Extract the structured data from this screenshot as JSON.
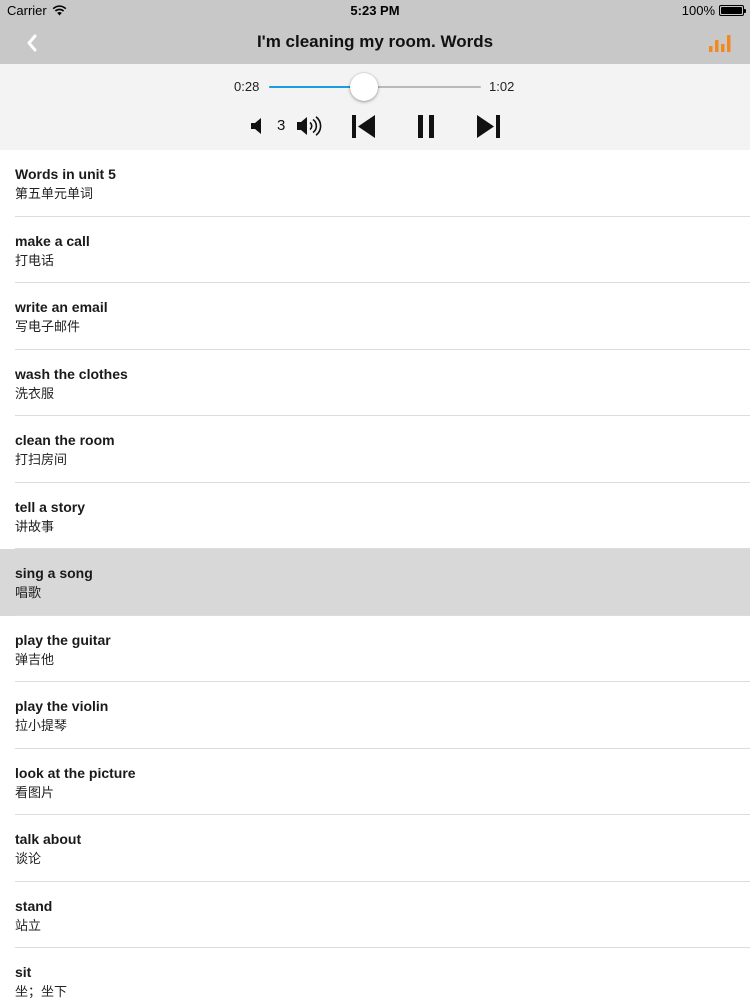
{
  "status_bar": {
    "carrier": "Carrier",
    "time": "5:23 PM",
    "battery": "100%",
    "battery_level": 1.0
  },
  "nav": {
    "title": "I'm cleaning my room. Words",
    "back_icon": "chevron-left-icon",
    "chart_icon": "bar-chart-icon",
    "chart_color": "#f08a1c"
  },
  "player": {
    "current_time": "0:28",
    "total_time": "1:02",
    "progress": 0.45,
    "volume": "3",
    "accent_color": "#1a9ce5"
  },
  "words": [
    {
      "en": "Words in unit 5",
      "zh": "第五单元单词"
    },
    {
      "en": "make a call",
      "zh": "打电话"
    },
    {
      "en": "write an email",
      "zh": "写电子邮件"
    },
    {
      "en": "wash the clothes",
      "zh": "洗衣服"
    },
    {
      "en": "clean the room",
      "zh": "打扫房间"
    },
    {
      "en": "tell a story",
      "zh": "讲故事"
    },
    {
      "en": "sing a song",
      "zh": "唱歌",
      "selected": true
    },
    {
      "en": "play the guitar",
      "zh": "弹吉他"
    },
    {
      "en": "play the violin",
      "zh": "拉小提琴"
    },
    {
      "en": "look at the picture",
      "zh": "看图片"
    },
    {
      "en": "talk about",
      "zh": "谈论"
    },
    {
      "en": "stand",
      "zh": "站立"
    },
    {
      "en": "sit",
      "zh": "坐；坐下"
    }
  ]
}
